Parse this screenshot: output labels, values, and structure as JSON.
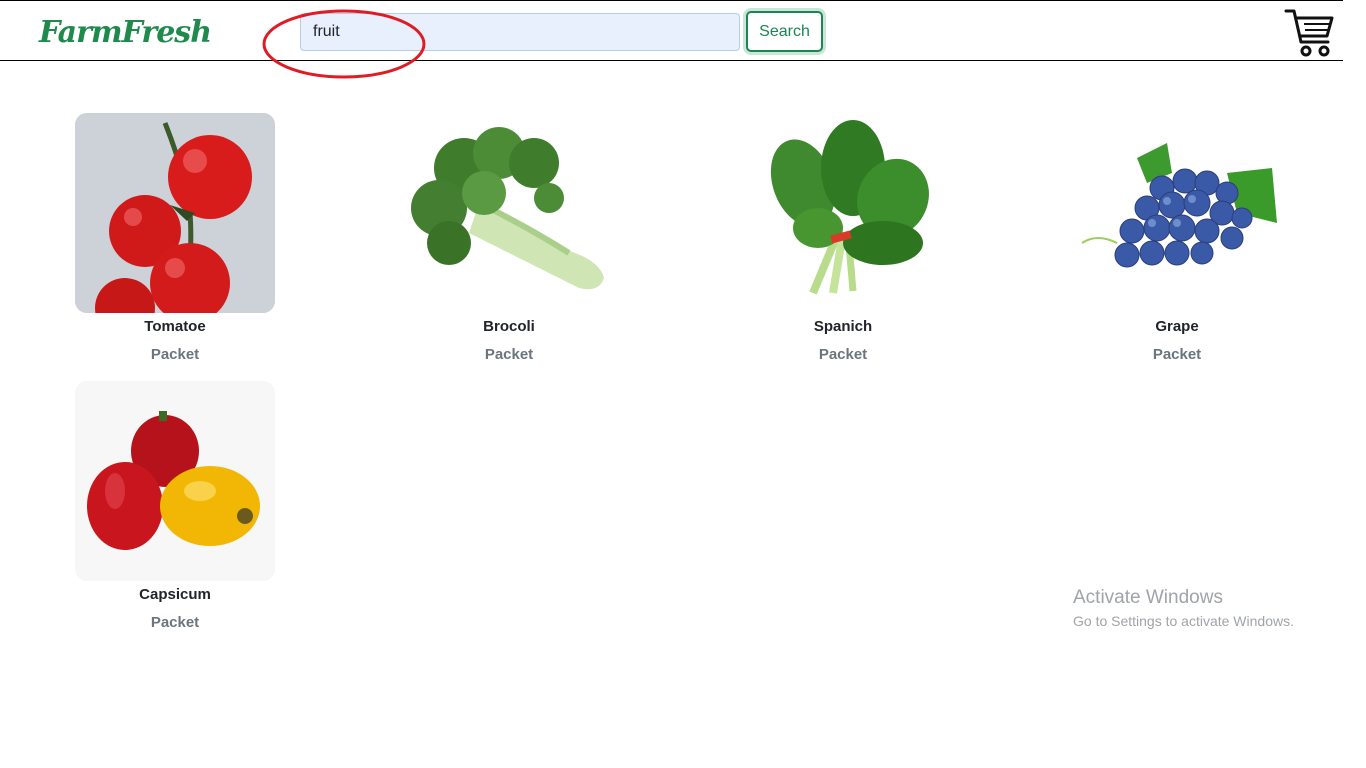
{
  "brand": {
    "name": "FarmFresh"
  },
  "search": {
    "value": "fruit",
    "button_label": "Search"
  },
  "icons": {
    "cart": "cart-icon",
    "logo": "grocery-bag-icon"
  },
  "annotation": {
    "shape": "ellipse",
    "color": "#e01b24"
  },
  "products": [
    {
      "name": "Tomatoe",
      "unit": "Packet"
    },
    {
      "name": "Brocoli",
      "unit": "Packet"
    },
    {
      "name": "Spanich",
      "unit": "Packet"
    },
    {
      "name": "Grape",
      "unit": "Packet"
    },
    {
      "name": "Capsicum",
      "unit": "Packet"
    }
  ],
  "os_watermark": {
    "title": "Activate Windows",
    "subtitle": "Go to Settings to activate Windows."
  },
  "colors": {
    "brand_green": "#1f8a4c",
    "button_green": "#198754",
    "muted": "#6c757d"
  }
}
